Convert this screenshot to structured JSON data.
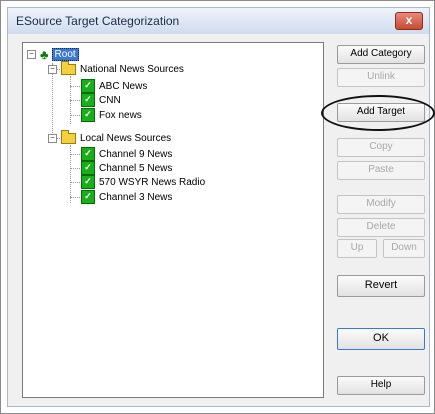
{
  "window": {
    "title": "ESource Target Categorization",
    "close_label": "x"
  },
  "tree": {
    "root": "Root",
    "categories": [
      {
        "label": "National News Sources",
        "items": [
          "ABC News",
          "CNN",
          "Fox news"
        ]
      },
      {
        "label": "Local News Sources",
        "items": [
          "Channel 9 News",
          "Channel 5 News",
          "570 WSYR News Radio",
          "Channel 3 News"
        ]
      }
    ]
  },
  "buttons": {
    "add_category": "Add Category",
    "unlink": "Unlink",
    "add_target": "Add Target",
    "copy": "Copy",
    "paste": "Paste",
    "modify": "Modify",
    "delete": "Delete",
    "up": "Up",
    "down": "Down",
    "revert": "Revert",
    "ok": "OK",
    "help": "Help"
  },
  "icons": {
    "root": "tree-icon",
    "category": "folder-icon",
    "target": "target-check-icon",
    "expander": "minus-expander-icon"
  },
  "colors": {
    "selection": "#3a78d6",
    "target_icon": "#18b018",
    "folder": "#f4d03f"
  }
}
